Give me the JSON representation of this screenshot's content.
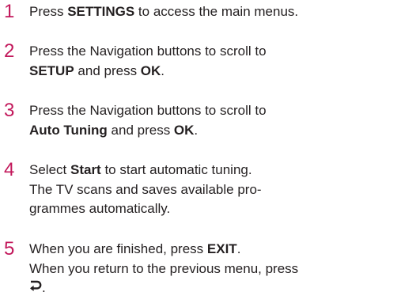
{
  "colors": {
    "step_number": "#c2185b",
    "text": "#231f20"
  },
  "steps": [
    {
      "number": "1",
      "lines": [
        {
          "pre": "Press ",
          "bold": "SETTINGS",
          "post": " to access the main menus."
        }
      ]
    },
    {
      "number": "2",
      "lines": [
        {
          "text": "Press the Navigation buttons to scroll to"
        },
        {
          "bold": "SETUP",
          "mid": " and press ",
          "bold2": "OK",
          "post": "."
        }
      ]
    },
    {
      "number": "3",
      "lines": [
        {
          "text": "Press the Navigation buttons to scroll to"
        },
        {
          "bold": "Auto Tuning",
          "mid": " and press ",
          "bold2": "OK",
          "post": "."
        }
      ]
    },
    {
      "number": "4",
      "lines": [
        {
          "pre": "Select ",
          "bold": "Start",
          "post": " to start automatic tuning."
        },
        {
          "text": "The TV scans and saves available pro-"
        },
        {
          "text": "grammes automatically."
        }
      ]
    },
    {
      "number": "5",
      "lines": [
        {
          "pre": "When you are finished, press ",
          "bold": "EXIT",
          "post": "."
        },
        {
          "text": "When you return to the previous menu, press"
        },
        {
          "post": "."
        }
      ],
      "icon": "back-arrow-icon"
    }
  ]
}
